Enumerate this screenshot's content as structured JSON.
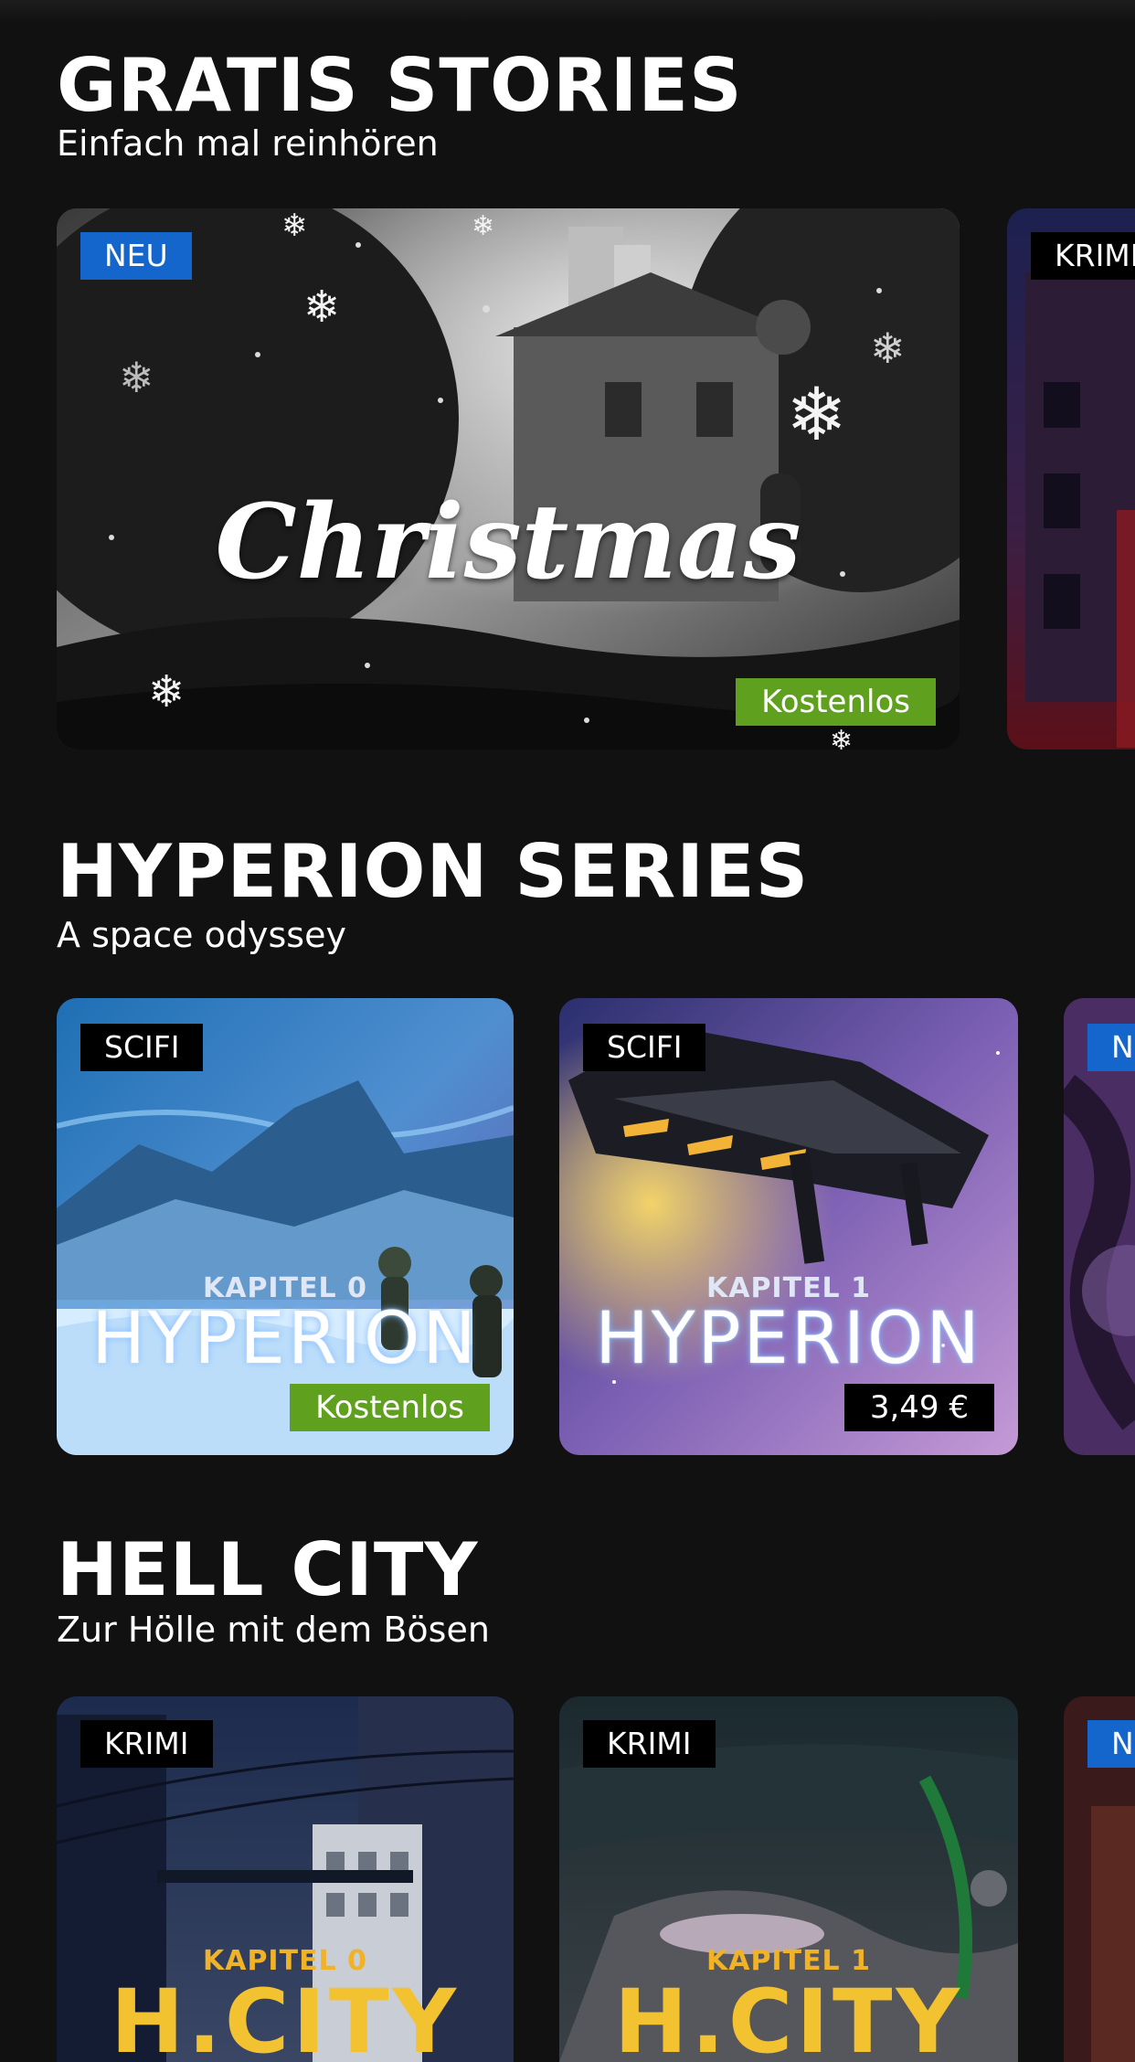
{
  "sections": [
    {
      "title": "GRATIS STORIES",
      "subtitle": "Einfach mal reinhören",
      "cards": [
        {
          "tag": "NEU",
          "tag_color": "#1466cc",
          "cover_title": "Christmas",
          "price": "Kostenlos",
          "price_color": "#5fa11e"
        },
        {
          "tag": "KRIMI",
          "tag_color": "#000000"
        }
      ]
    },
    {
      "title": "HYPERION SERIES",
      "subtitle": "A space odyssey",
      "cards": [
        {
          "tag": "SCIFI",
          "tag_color": "#000000",
          "cover_chapter": "KAPITEL 0",
          "cover_title": "HYPERION",
          "price": "Kostenlos",
          "price_color": "#5fa11e"
        },
        {
          "tag": "SCIFI",
          "tag_color": "#000000",
          "cover_chapter": "KAPITEL 1",
          "cover_title": "HYPERION",
          "price": "3,49 €",
          "price_color": "#000000"
        },
        {
          "tag": "NEU",
          "tag_color": "#1466cc"
        }
      ]
    },
    {
      "title": "HELL CITY",
      "subtitle": "Zur Hölle mit dem Bösen",
      "cards": [
        {
          "tag": "KRIMI",
          "tag_color": "#000000",
          "cover_chapter": "KAPITEL 0",
          "cover_title": "H.CITY"
        },
        {
          "tag": "KRIMI",
          "tag_color": "#000000",
          "cover_chapter": "KAPITEL 1",
          "cover_title": "H.CITY"
        },
        {
          "tag": "NEU",
          "tag_color": "#1466cc"
        }
      ]
    }
  ],
  "colors": {
    "background": "#111111",
    "tag_new": "#1466cc",
    "tag_genre": "#000000",
    "price_free": "#5fa11e"
  },
  "icons": [
    "snowflake-icon"
  ]
}
